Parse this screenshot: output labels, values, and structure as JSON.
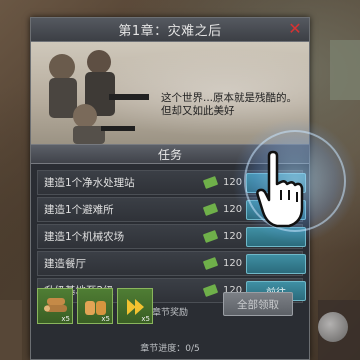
{
  "dialog": {
    "title": "第1章：灾难之后",
    "close_label": "✕"
  },
  "story": {
    "line1": "这个世界...原本就是残酷的。",
    "line2": "但却又如此美好"
  },
  "tasks_header": "任务",
  "tasks": [
    {
      "name": "建造1个净水处理站",
      "reward": "120",
      "action": ""
    },
    {
      "name": "建造1个避难所",
      "reward": "120",
      "action": ""
    },
    {
      "name": "建造1个机械农场",
      "reward": "120",
      "action": ""
    },
    {
      "name": "建造餐厅",
      "reward": "120",
      "action": ""
    },
    {
      "name": "升级基地至2级",
      "reward": "120",
      "action": "前往"
    }
  ],
  "chapter_rewards": {
    "title": "章节奖励",
    "items": [
      {
        "icon": "wood-icon",
        "count": "x5"
      },
      {
        "icon": "bread-icon",
        "count": "x5"
      },
      {
        "icon": "speedup-icon",
        "count": "x5"
      }
    ],
    "claim_all_label": "全部领取"
  },
  "chapter_progress": "章节进度：0/5",
  "colors": {
    "button_teal": "#2b6b7c",
    "reward_green": "#4f7d34",
    "close_red": "#d83232"
  }
}
